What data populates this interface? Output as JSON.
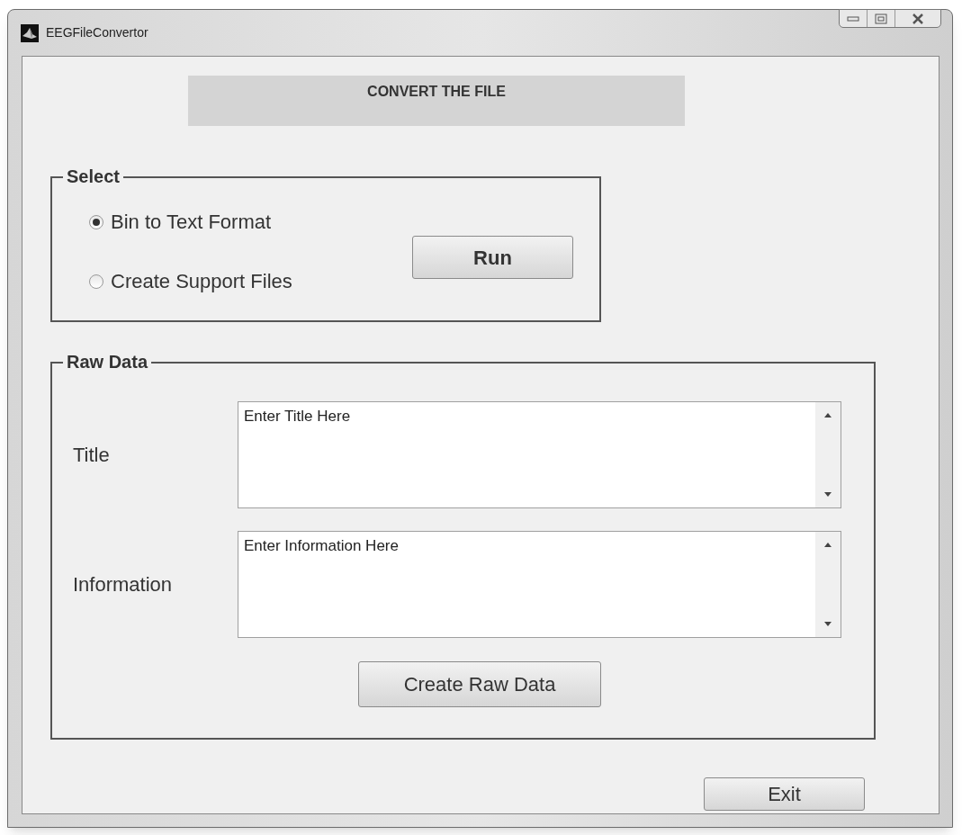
{
  "window": {
    "title": "EEGFileConvertor"
  },
  "heading": "CONVERT THE FILE",
  "select_panel": {
    "legend": "Select",
    "options": [
      {
        "label": "Bin to Text Format",
        "selected": true
      },
      {
        "label": "Create Support Files",
        "selected": false
      }
    ],
    "run_button": "Run"
  },
  "raw_data_panel": {
    "legend": "Raw Data",
    "fields": [
      {
        "label": "Title",
        "value": "Enter Title Here"
      },
      {
        "label": "Information",
        "value": "Enter Information Here"
      }
    ],
    "create_button": "Create Raw Data"
  },
  "exit_button": "Exit"
}
